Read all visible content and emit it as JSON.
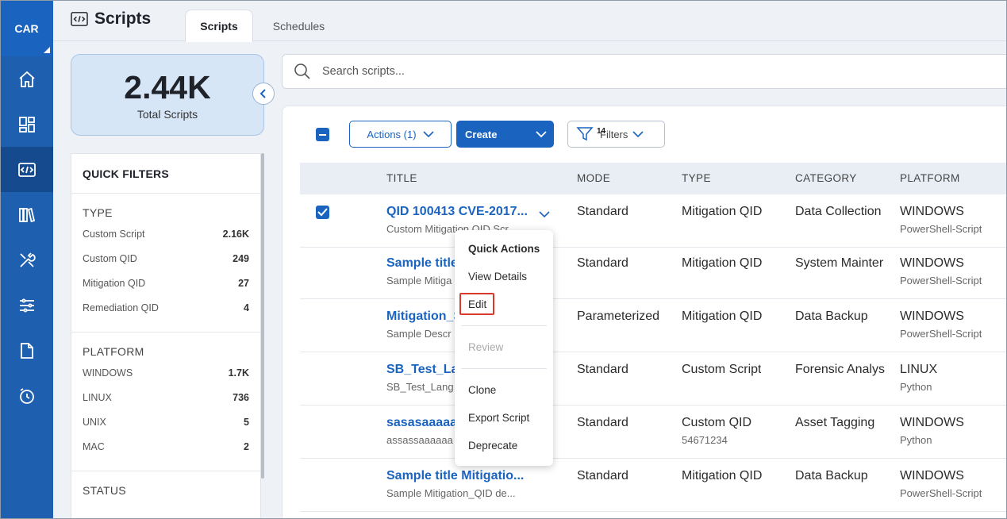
{
  "app": {
    "name": "CAR"
  },
  "nav": {
    "items": [
      {
        "icon": "home-icon"
      },
      {
        "icon": "dashboard-icon"
      },
      {
        "icon": "scripts-icon",
        "active": true
      },
      {
        "icon": "library-icon"
      },
      {
        "icon": "tools-icon"
      },
      {
        "icon": "sliders-icon"
      },
      {
        "icon": "document-icon"
      },
      {
        "icon": "history-icon"
      }
    ]
  },
  "header": {
    "title": "Scripts",
    "tabs": [
      {
        "label": "Scripts",
        "active": true
      },
      {
        "label": "Schedules",
        "active": false
      }
    ]
  },
  "summary": {
    "value": "2.44K",
    "label": "Total Scripts"
  },
  "quick_filters": {
    "title": "QUICK FILTERS",
    "type": {
      "heading": "TYPE",
      "items": [
        {
          "label": "Custom Script",
          "count": "2.16K"
        },
        {
          "label": "Custom QID",
          "count": "249"
        },
        {
          "label": "Mitigation QID",
          "count": "27"
        },
        {
          "label": "Remediation QID",
          "count": "4"
        }
      ]
    },
    "platform": {
      "heading": "PLATFORM",
      "items": [
        {
          "label": "WINDOWS",
          "count": "1.7K"
        },
        {
          "label": "LINUX",
          "count": "736"
        },
        {
          "label": "UNIX",
          "count": "5"
        },
        {
          "label": "MAC",
          "count": "2"
        }
      ]
    },
    "status": {
      "heading": "STATUS"
    }
  },
  "search": {
    "placeholder": "Search scripts..."
  },
  "toolbar": {
    "actions_label": "Actions (1)",
    "create_label": "Create",
    "filters_label": "Filters",
    "filters_count": "14"
  },
  "table": {
    "columns": [
      "TITLE",
      "MODE",
      "TYPE",
      "CATEGORY",
      "PLATFORM"
    ],
    "rows": [
      {
        "title": "QID 100413 CVE-2017...",
        "subtitle": "Custom Mitigation QID Scr",
        "mode": "Standard",
        "type": "Mitigation QID",
        "type_sub": "",
        "category": "Data Collection",
        "platform": "WINDOWS",
        "platform_sub": "PowerShell-Script",
        "selected": true
      },
      {
        "title": "Sample title",
        "subtitle": "Sample Mitiga",
        "mode": "Standard",
        "type": "Mitigation QID",
        "type_sub": "",
        "category": "System Mainter",
        "platform": "WINDOWS",
        "platform_sub": "PowerShell-Script",
        "selected": false
      },
      {
        "title": "Mitigation_S",
        "subtitle": "Sample Descr",
        "mode": "Parameterized",
        "type": "Mitigation QID",
        "type_sub": "",
        "category": "Data Backup",
        "platform": "WINDOWS",
        "platform_sub": "PowerShell-Script",
        "selected": false
      },
      {
        "title": "SB_Test_La",
        "subtitle": "SB_Test_Lang",
        "mode": "Standard",
        "type": "Custom Script",
        "type_sub": "",
        "category": "Forensic Analys",
        "platform": "LINUX",
        "platform_sub": "Python",
        "selected": false
      },
      {
        "title": "sasasaaaaa",
        "subtitle": "assassaaaaaa",
        "mode": "Standard",
        "type": "Custom QID",
        "type_sub": "54671234",
        "category": "Asset Tagging",
        "platform": "WINDOWS",
        "platform_sub": "Python",
        "selected": false
      },
      {
        "title": "Sample title Mitigatio...",
        "subtitle": "Sample Mitigation_QID de...",
        "mode": "Standard",
        "type": "Mitigation QID",
        "type_sub": "",
        "category": "Data Backup",
        "platform": "WINDOWS",
        "platform_sub": "PowerShell-Script",
        "selected": false
      }
    ]
  },
  "row_menu": {
    "heading": "Quick Actions",
    "view_details": "View Details",
    "edit": "Edit",
    "review": "Review",
    "clone": "Clone",
    "export": "Export Script",
    "deprecate": "Deprecate"
  },
  "colors": {
    "primary": "#1a64c0",
    "rail": "#1e5fb0",
    "highlight": "#d9392c"
  }
}
